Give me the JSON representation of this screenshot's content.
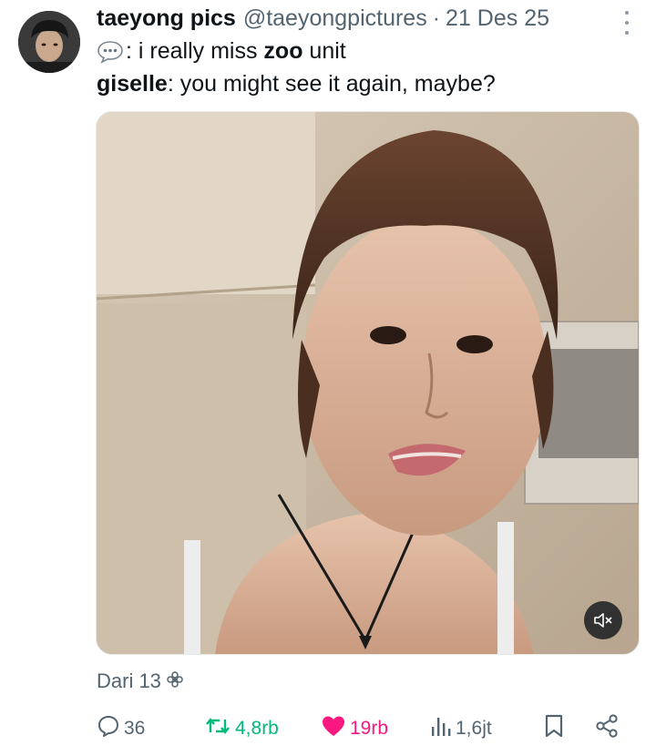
{
  "tweet": {
    "author_name": "taeyong pics",
    "author_handle": "@taeyongpictures",
    "separator": "·",
    "date": "21 Des 25",
    "line1": {
      "emoji_label": "speech-bubble-emoji",
      "prefix": ":",
      "text_before": " i really miss ",
      "bold_text": "zoo",
      "text_after": " unit"
    },
    "line2": {
      "speaker": "giselle",
      "text": ": you might see it again, maybe?"
    },
    "source": "Dari 13",
    "media": {
      "type": "video",
      "mute_icon": "speaker-muted-icon"
    }
  },
  "actions": {
    "replies": "36",
    "reposts": "4,8rb",
    "likes": "19rb",
    "views": "1,6jt"
  },
  "icons": {
    "more": "more-vertical-icon",
    "reply": "reply-icon",
    "repost": "repost-icon",
    "like": "heart-icon",
    "views": "views-icon",
    "bookmark": "bookmark-icon",
    "share": "share-icon",
    "source": "flower-icon"
  },
  "colors": {
    "text_primary": "#0f1419",
    "text_secondary": "#536471",
    "repost_active": "#00ba7c",
    "like_active": "#f91880"
  }
}
